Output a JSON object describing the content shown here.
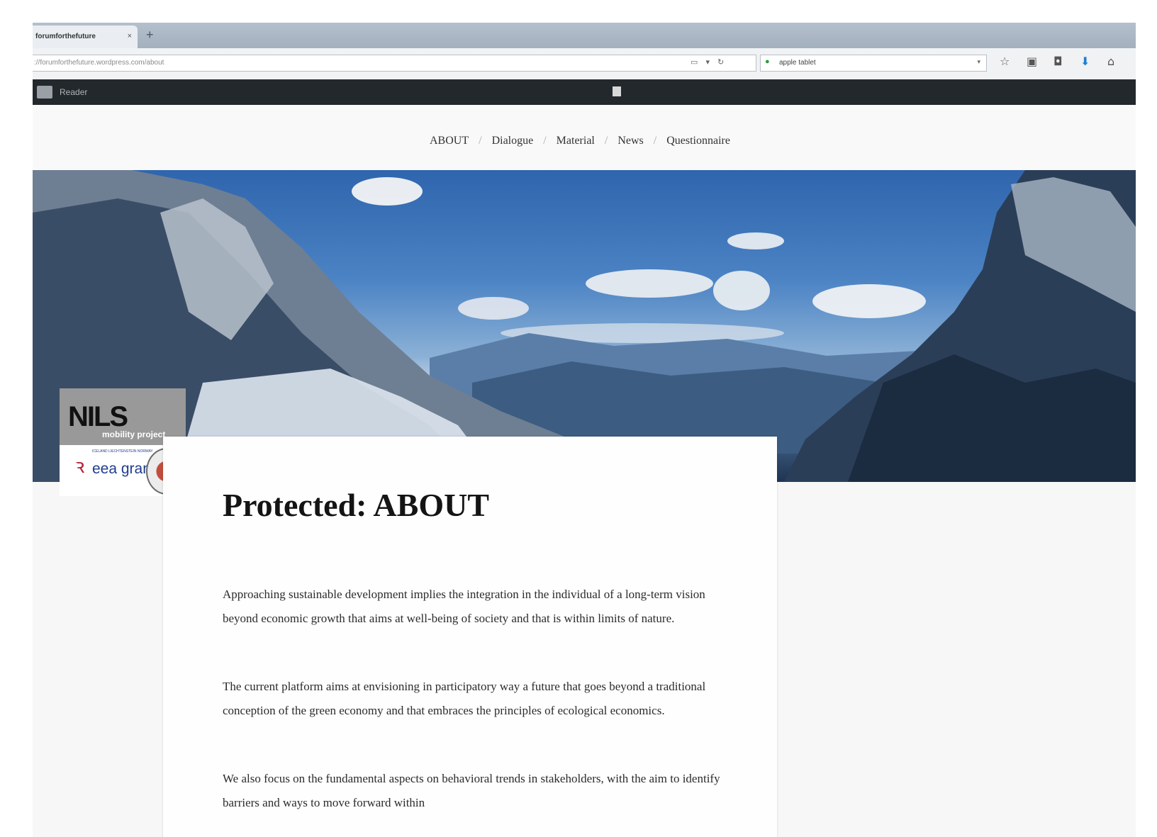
{
  "browser": {
    "tab_title": "forumforthefuture",
    "tab_close": "×",
    "new_tab": "+",
    "url_prefix": "://forumforthefuture.wordpress.com/about",
    "url_controls": "▭ ▾ ↻",
    "search_query": "apple tablet",
    "search_dropdown": "▾",
    "toolbar_icons": [
      "star-icon",
      "clipboard-icon",
      "pocket-icon",
      "download-icon",
      "home-icon"
    ]
  },
  "wp_admin": {
    "reader_label": "Reader"
  },
  "site_nav": {
    "items": [
      "ABOUT",
      "Dialogue",
      "Material",
      "News",
      "Questionnaire"
    ],
    "separator": "/"
  },
  "logo": {
    "nils": "NILS",
    "nils_sub": "mobility project",
    "eea_countries": "ICELAND LIECHTENSTEIN NORWAY",
    "eea_text": "eea grants"
  },
  "page": {
    "title": "Protected: ABOUT",
    "paragraphs": [
      "Approaching sustainable development implies the integration in the individual of a long-term vision beyond economic growth that aims at well-being of society and that is within limits of nature.",
      "The current platform aims at envisioning in participatory way a future that goes beyond a traditional conception of the green economy and that embraces the principles of ecological economics.",
      "We also focus on the fundamental aspects on behavioral trends in stakeholders, with the aim to identify barriers and ways to move forward within"
    ]
  },
  "colors": {
    "admin_bar": "#23282d",
    "tab_strip": "#a3b0bd",
    "sky": "#4b83c4",
    "title_text": "#141414"
  }
}
